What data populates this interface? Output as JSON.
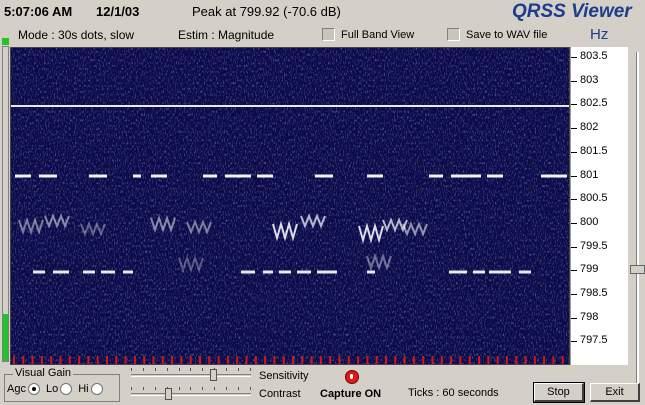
{
  "header": {
    "time": "5:07:06 AM",
    "date": "12/1/03",
    "peak": "Peak at  799.92 (-70.6 dB)",
    "app_title": "QRSS Viewer"
  },
  "info": {
    "mode": "Mode : 30s dots, slow",
    "estim": "Estim : Magnitude",
    "full_band_label": "Full Band View",
    "save_wav_label": "Save to WAV file",
    "full_band_checked": false,
    "save_wav_checked": false,
    "units": "Hz"
  },
  "freq_axis": {
    "labels": [
      "803.5",
      "803",
      "802.5",
      "802",
      "801.5",
      "801",
      "800.5",
      "800",
      "799.5",
      "799",
      "798.5",
      "798",
      "797.5"
    ]
  },
  "meters": {
    "left_level": 0.15,
    "right_slider_level": 0.63
  },
  "controls": {
    "visual_gain_label": "Visual Gain",
    "agc_label": "Agc",
    "lo_label": "Lo",
    "hi_label": "Hi",
    "selected_gain": "Agc",
    "sensitivity_label": "Sensitivity",
    "contrast_label": "Contrast",
    "sensitivity_value": 0.7,
    "contrast_value": 0.3,
    "capture_label": "Capture ON",
    "ticks_label": "Ticks  : 60 seconds",
    "stop_label": "Stop",
    "exit_label": "Exit"
  },
  "colors": {
    "spectrogram_bg": "#0b0b4a",
    "trace": "#ffffff",
    "tick_marker": "#d01818",
    "title": "#1c3d8c",
    "led_green": "#22c422",
    "capture_led": "#e01818"
  }
}
